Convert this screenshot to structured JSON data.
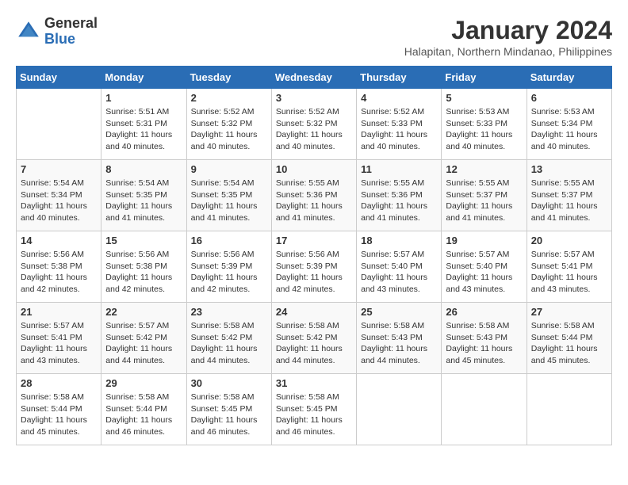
{
  "header": {
    "logo_general": "General",
    "logo_blue": "Blue",
    "month_year": "January 2024",
    "location": "Halapitan, Northern Mindanao, Philippines"
  },
  "days_of_week": [
    "Sunday",
    "Monday",
    "Tuesday",
    "Wednesday",
    "Thursday",
    "Friday",
    "Saturday"
  ],
  "weeks": [
    [
      {
        "day": "",
        "sunrise": "",
        "sunset": "",
        "daylight": ""
      },
      {
        "day": "1",
        "sunrise": "Sunrise: 5:51 AM",
        "sunset": "Sunset: 5:31 PM",
        "daylight": "Daylight: 11 hours and 40 minutes."
      },
      {
        "day": "2",
        "sunrise": "Sunrise: 5:52 AM",
        "sunset": "Sunset: 5:32 PM",
        "daylight": "Daylight: 11 hours and 40 minutes."
      },
      {
        "day": "3",
        "sunrise": "Sunrise: 5:52 AM",
        "sunset": "Sunset: 5:32 PM",
        "daylight": "Daylight: 11 hours and 40 minutes."
      },
      {
        "day": "4",
        "sunrise": "Sunrise: 5:52 AM",
        "sunset": "Sunset: 5:33 PM",
        "daylight": "Daylight: 11 hours and 40 minutes."
      },
      {
        "day": "5",
        "sunrise": "Sunrise: 5:53 AM",
        "sunset": "Sunset: 5:33 PM",
        "daylight": "Daylight: 11 hours and 40 minutes."
      },
      {
        "day": "6",
        "sunrise": "Sunrise: 5:53 AM",
        "sunset": "Sunset: 5:34 PM",
        "daylight": "Daylight: 11 hours and 40 minutes."
      }
    ],
    [
      {
        "day": "7",
        "sunrise": "Sunrise: 5:54 AM",
        "sunset": "Sunset: 5:34 PM",
        "daylight": "Daylight: 11 hours and 40 minutes."
      },
      {
        "day": "8",
        "sunrise": "Sunrise: 5:54 AM",
        "sunset": "Sunset: 5:35 PM",
        "daylight": "Daylight: 11 hours and 41 minutes."
      },
      {
        "day": "9",
        "sunrise": "Sunrise: 5:54 AM",
        "sunset": "Sunset: 5:35 PM",
        "daylight": "Daylight: 11 hours and 41 minutes."
      },
      {
        "day": "10",
        "sunrise": "Sunrise: 5:55 AM",
        "sunset": "Sunset: 5:36 PM",
        "daylight": "Daylight: 11 hours and 41 minutes."
      },
      {
        "day": "11",
        "sunrise": "Sunrise: 5:55 AM",
        "sunset": "Sunset: 5:36 PM",
        "daylight": "Daylight: 11 hours and 41 minutes."
      },
      {
        "day": "12",
        "sunrise": "Sunrise: 5:55 AM",
        "sunset": "Sunset: 5:37 PM",
        "daylight": "Daylight: 11 hours and 41 minutes."
      },
      {
        "day": "13",
        "sunrise": "Sunrise: 5:55 AM",
        "sunset": "Sunset: 5:37 PM",
        "daylight": "Daylight: 11 hours and 41 minutes."
      }
    ],
    [
      {
        "day": "14",
        "sunrise": "Sunrise: 5:56 AM",
        "sunset": "Sunset: 5:38 PM",
        "daylight": "Daylight: 11 hours and 42 minutes."
      },
      {
        "day": "15",
        "sunrise": "Sunrise: 5:56 AM",
        "sunset": "Sunset: 5:38 PM",
        "daylight": "Daylight: 11 hours and 42 minutes."
      },
      {
        "day": "16",
        "sunrise": "Sunrise: 5:56 AM",
        "sunset": "Sunset: 5:39 PM",
        "daylight": "Daylight: 11 hours and 42 minutes."
      },
      {
        "day": "17",
        "sunrise": "Sunrise: 5:56 AM",
        "sunset": "Sunset: 5:39 PM",
        "daylight": "Daylight: 11 hours and 42 minutes."
      },
      {
        "day": "18",
        "sunrise": "Sunrise: 5:57 AM",
        "sunset": "Sunset: 5:40 PM",
        "daylight": "Daylight: 11 hours and 43 minutes."
      },
      {
        "day": "19",
        "sunrise": "Sunrise: 5:57 AM",
        "sunset": "Sunset: 5:40 PM",
        "daylight": "Daylight: 11 hours and 43 minutes."
      },
      {
        "day": "20",
        "sunrise": "Sunrise: 5:57 AM",
        "sunset": "Sunset: 5:41 PM",
        "daylight": "Daylight: 11 hours and 43 minutes."
      }
    ],
    [
      {
        "day": "21",
        "sunrise": "Sunrise: 5:57 AM",
        "sunset": "Sunset: 5:41 PM",
        "daylight": "Daylight: 11 hours and 43 minutes."
      },
      {
        "day": "22",
        "sunrise": "Sunrise: 5:57 AM",
        "sunset": "Sunset: 5:42 PM",
        "daylight": "Daylight: 11 hours and 44 minutes."
      },
      {
        "day": "23",
        "sunrise": "Sunrise: 5:58 AM",
        "sunset": "Sunset: 5:42 PM",
        "daylight": "Daylight: 11 hours and 44 minutes."
      },
      {
        "day": "24",
        "sunrise": "Sunrise: 5:58 AM",
        "sunset": "Sunset: 5:42 PM",
        "daylight": "Daylight: 11 hours and 44 minutes."
      },
      {
        "day": "25",
        "sunrise": "Sunrise: 5:58 AM",
        "sunset": "Sunset: 5:43 PM",
        "daylight": "Daylight: 11 hours and 44 minutes."
      },
      {
        "day": "26",
        "sunrise": "Sunrise: 5:58 AM",
        "sunset": "Sunset: 5:43 PM",
        "daylight": "Daylight: 11 hours and 45 minutes."
      },
      {
        "day": "27",
        "sunrise": "Sunrise: 5:58 AM",
        "sunset": "Sunset: 5:44 PM",
        "daylight": "Daylight: 11 hours and 45 minutes."
      }
    ],
    [
      {
        "day": "28",
        "sunrise": "Sunrise: 5:58 AM",
        "sunset": "Sunset: 5:44 PM",
        "daylight": "Daylight: 11 hours and 45 minutes."
      },
      {
        "day": "29",
        "sunrise": "Sunrise: 5:58 AM",
        "sunset": "Sunset: 5:44 PM",
        "daylight": "Daylight: 11 hours and 46 minutes."
      },
      {
        "day": "30",
        "sunrise": "Sunrise: 5:58 AM",
        "sunset": "Sunset: 5:45 PM",
        "daylight": "Daylight: 11 hours and 46 minutes."
      },
      {
        "day": "31",
        "sunrise": "Sunrise: 5:58 AM",
        "sunset": "Sunset: 5:45 PM",
        "daylight": "Daylight: 11 hours and 46 minutes."
      },
      {
        "day": "",
        "sunrise": "",
        "sunset": "",
        "daylight": ""
      },
      {
        "day": "",
        "sunrise": "",
        "sunset": "",
        "daylight": ""
      },
      {
        "day": "",
        "sunrise": "",
        "sunset": "",
        "daylight": ""
      }
    ]
  ]
}
